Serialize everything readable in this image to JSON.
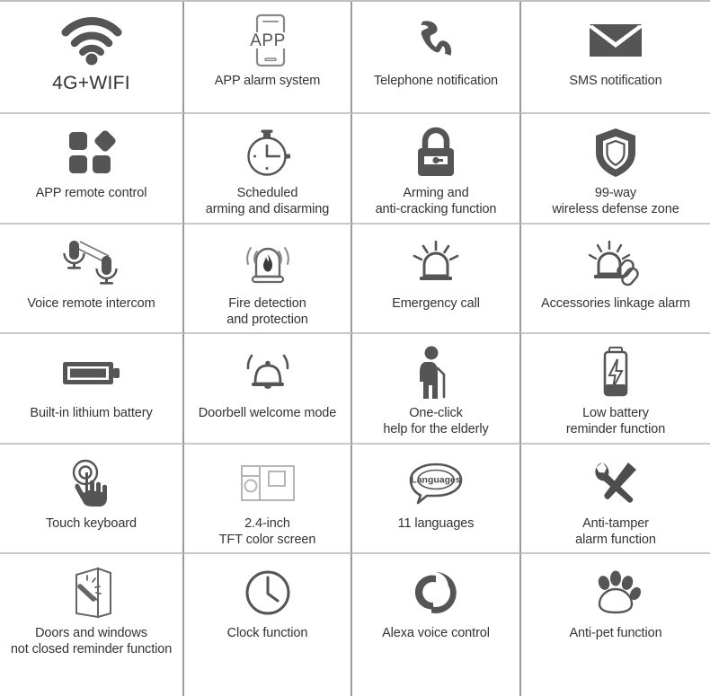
{
  "page": {
    "title": "Alarm system feature grid",
    "accent_color": "#555555",
    "text_color": "#333333",
    "grid_line_color": "#9a9a9a",
    "background": "#ffffff",
    "columns": 4,
    "rows": 6
  },
  "features": [
    {
      "icon": "wifi-icon",
      "label": "4G+WIFI",
      "emphasis": "big"
    },
    {
      "icon": "smartphone-app-icon",
      "label": "APP alarm system",
      "emphasis": "normal"
    },
    {
      "icon": "telephone-handset-icon",
      "label": "Telephone notification",
      "emphasis": "normal"
    },
    {
      "icon": "envelope-icon",
      "label": "SMS notification",
      "emphasis": "normal"
    },
    {
      "icon": "app-grid-icon",
      "label": "APP remote control",
      "emphasis": "normal"
    },
    {
      "icon": "stopwatch-icon",
      "label": "Scheduled\narming and disarming",
      "emphasis": "normal"
    },
    {
      "icon": "padlock-icon",
      "label": "Arming and\nanti-cracking function",
      "emphasis": "normal"
    },
    {
      "icon": "shield-icon",
      "label": "99-way\nwireless defense zone",
      "emphasis": "normal"
    },
    {
      "icon": "two-microphones-icon",
      "label": "Voice remote intercom",
      "emphasis": "normal"
    },
    {
      "icon": "fire-detector-icon",
      "label": "Fire detection\nand protection",
      "emphasis": "normal"
    },
    {
      "icon": "siren-light-icon",
      "label": "Emergency call",
      "emphasis": "normal"
    },
    {
      "icon": "siren-linkage-icon",
      "label": "Accessories linkage alarm",
      "emphasis": "normal"
    },
    {
      "icon": "battery-full-icon",
      "label": "Built-in lithium battery",
      "emphasis": "normal"
    },
    {
      "icon": "doorbell-ringing-icon",
      "label": "Doorbell welcome mode",
      "emphasis": "normal"
    },
    {
      "icon": "elderly-person-icon",
      "label": "One-click\nhelp for the elderly",
      "emphasis": "normal"
    },
    {
      "icon": "battery-low-bolt-icon",
      "label": "Low battery\nreminder function",
      "emphasis": "normal"
    },
    {
      "icon": "touch-hand-icon",
      "label": "Touch keyboard",
      "emphasis": "normal"
    },
    {
      "icon": "tft-screen-icon",
      "label": "2.4-inch\nTFT color screen",
      "emphasis": "normal"
    },
    {
      "icon": "speech-bubble-icon",
      "label": "11 languages",
      "emphasis": "normal"
    },
    {
      "icon": "wrench-screwdriver-icon",
      "label": "Anti-tamper\nalarm function",
      "emphasis": "normal"
    },
    {
      "icon": "open-door-window-icon",
      "label": "Doors and windows\nnot closed reminder function",
      "emphasis": "normal"
    },
    {
      "icon": "clock-icon",
      "label": "Clock function",
      "emphasis": "normal"
    },
    {
      "icon": "alexa-ring-icon",
      "label": "Alexa voice control",
      "emphasis": "normal"
    },
    {
      "icon": "paw-print-icon",
      "label": "Anti-pet function",
      "emphasis": "normal"
    }
  ],
  "icon_inline_text": {
    "app": "APP",
    "languages": "Languages"
  }
}
